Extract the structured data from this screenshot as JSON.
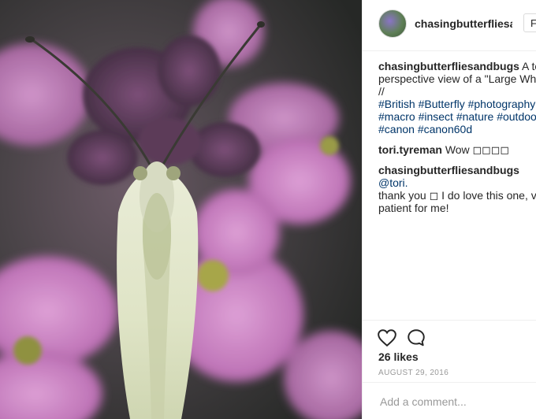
{
  "post": {
    "username": "chasingbutterfliesar",
    "follow_label": "Fo"
  },
  "caption": {
    "author": "chasingbutterfliesandbugs",
    "text_lines": [
      "A top",
      "perspective view of a \"Large Whit",
      "//"
    ],
    "hashtags_line1": [
      "#British",
      "#Butterfly",
      "#photography"
    ],
    "hashtags_line2": [
      "#macro",
      "#insect",
      "#nature",
      "#outdoo"
    ],
    "hashtags_line3": [
      "#canon",
      "#canon60d"
    ]
  },
  "comments": [
    {
      "author": "tori.tyreman",
      "text": "Wow ◻◻◻◻"
    },
    {
      "author": "chasingbutterfliesandbugs",
      "mention": "@tori.",
      "text_lines": [
        "thank you ◻ I do love this one, ve",
        "patient for me!"
      ]
    }
  ],
  "actions": {
    "likes": "26 likes",
    "date": "AUGUST 29, 2016",
    "add_comment_placeholder": "Add a comment..."
  },
  "colors": {
    "hashtag": "#003569",
    "flower": "#c97bc4",
    "background_dark": "#2b2c2b"
  },
  "icons": [
    "heart-icon",
    "comment-bubble-icon"
  ]
}
